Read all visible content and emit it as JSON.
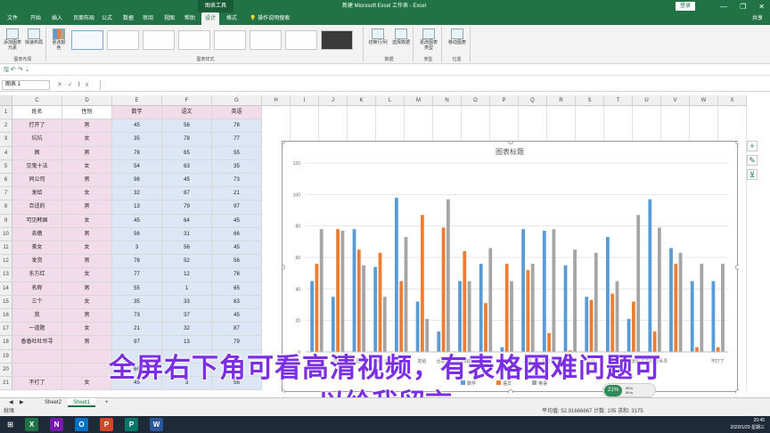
{
  "titlebar": {
    "context_tab": "图表工具",
    "title": "新建 Microsoft Excel 工作表 - Excel",
    "login": "登录",
    "min": "—",
    "restore": "❐",
    "close": "✕"
  },
  "ribbon_tabs": [
    "文件",
    "开始",
    "插入",
    "页面布局",
    "公式",
    "数据",
    "审阅",
    "视图",
    "帮助",
    "设计",
    "格式",
    "操作说明搜索"
  ],
  "active_tab": "设计",
  "share": "共享",
  "ribbon": {
    "add_element": "添加图表元素",
    "quick_layout": "快速布局",
    "layout_group": "图表布局",
    "change_colors": "更改颜色",
    "styles_group": "图表样式",
    "switch_rowcol": "切换行/列",
    "select_data": "选择数据",
    "data_group": "数据",
    "change_type": "更改图表类型",
    "type_group": "类型",
    "move_chart": "移动图表",
    "location_group": "位置"
  },
  "formula_bar": {
    "name_box": "图表 1",
    "cancel": "✕",
    "enter": "✓",
    "fx": "fx",
    "value": ""
  },
  "columns": [
    "C",
    "D",
    "E",
    "F",
    "G",
    "H",
    "I",
    "J",
    "K",
    "L",
    "M",
    "N",
    "O",
    "P",
    "Q",
    "R",
    "S",
    "T",
    "U",
    "V",
    "W",
    "X"
  ],
  "table": {
    "headers": [
      "姓名",
      "性别",
      "数学",
      "语文",
      "英语"
    ],
    "rows": [
      [
        "打开了",
        "男",
        "45",
        "56",
        "78"
      ],
      [
        "坑坑",
        "女",
        "35",
        "78",
        "77"
      ],
      [
        "困",
        "男",
        "78",
        "65",
        "55"
      ],
      [
        "见鬼十法",
        "女",
        "54",
        "63",
        "35"
      ],
      [
        "同公司",
        "男",
        "98",
        "45",
        "73"
      ],
      [
        "发给",
        "女",
        "32",
        "87",
        "21"
      ],
      [
        "合适的",
        "男",
        "13",
        "79",
        "97"
      ],
      [
        "可见韩国",
        "女",
        "45",
        "64",
        "45"
      ],
      [
        "去傲",
        "男",
        "56",
        "31",
        "66"
      ],
      [
        "美女",
        "女",
        "3",
        "56",
        "45"
      ],
      [
        "发货",
        "男",
        "78",
        "52",
        "56"
      ],
      [
        "东方红",
        "女",
        "77",
        "12",
        "78"
      ],
      [
        "名称",
        "男",
        "55",
        "1",
        "65"
      ],
      [
        "三个",
        "女",
        "35",
        "33",
        "63"
      ],
      [
        "我",
        "男",
        "73",
        "37",
        "45"
      ],
      [
        "一道题",
        "女",
        "21",
        "32",
        "87"
      ],
      [
        "香香吐吐吊寻",
        "男",
        "97",
        "13",
        "79"
      ],
      [
        "",
        "",
        "",
        "",
        ""
      ],
      [
        "",
        "",
        "66",
        "",
        ""
      ],
      [
        "不打了",
        "女",
        "45",
        "3",
        "56"
      ]
    ]
  },
  "row_numbers": [
    "1",
    "2",
    "3",
    "4",
    "5",
    "6",
    "7",
    "8",
    "9",
    "10",
    "11",
    "12",
    "13",
    "14",
    "15",
    "16",
    "17",
    "18",
    "19",
    "20",
    "21"
  ],
  "chart_data": {
    "type": "bar",
    "title": "图表标题",
    "ylim": [
      0,
      120
    ],
    "yticks": [
      "0",
      "20",
      "40",
      "60",
      "80",
      "100",
      "120"
    ],
    "categories": [
      "打开了",
      "坑坑",
      "困",
      "见鬼十法",
      "同公司",
      "发给",
      "合适的",
      "可见韩国",
      "去傲",
      "美女",
      "发货",
      "东方红",
      "名称",
      "三个",
      "我",
      "一道题",
      "香香吐吐吊寻",
      "",
      "",
      "不打了"
    ],
    "series": [
      {
        "name": "数学",
        "color": "#5b9bd5",
        "values": [
          45,
          35,
          78,
          54,
          98,
          32,
          13,
          45,
          56,
          3,
          78,
          77,
          55,
          35,
          73,
          21,
          97,
          66,
          45,
          45
        ]
      },
      {
        "name": "语文",
        "color": "#ed7d31",
        "values": [
          56,
          78,
          65,
          63,
          45,
          87,
          79,
          64,
          31,
          56,
          52,
          12,
          1,
          33,
          37,
          32,
          13,
          56,
          3,
          3
        ]
      },
      {
        "name": "英语",
        "color": "#a5a5a5",
        "values": [
          78,
          77,
          55,
          35,
          73,
          21,
          97,
          45,
          66,
          45,
          56,
          78,
          65,
          63,
          45,
          87,
          79,
          63,
          56,
          56
        ]
      }
    ],
    "legend_position": "bottom"
  },
  "chart_tools": {
    "add": "+",
    "style": "✎",
    "filter": "⊻"
  },
  "overlay": {
    "line1": "全屏右下角可看高清视频，有表格困难问题可",
    "line2": "以给我留言"
  },
  "sheets": [
    "Sheet2",
    "Sheet1"
  ],
  "active_sheet": "Sheet1",
  "add_sheet": "+",
  "status": {
    "ready": "就绪",
    "stats": "平均值: 52.91666667   计数: 105   求和: 3175"
  },
  "speed": {
    "pct": "21%",
    "up": "0K/s",
    "down": "0K/s"
  },
  "clock": {
    "time": "20:45",
    "date": "2020/1/29 星期三"
  },
  "taskbar_apps": [
    {
      "icon": "excel-icon",
      "label": "X",
      "color": "#217346"
    },
    {
      "icon": "onenote-icon",
      "label": "N",
      "color": "#7719aa"
    },
    {
      "icon": "outlook-icon",
      "label": "O",
      "color": "#0072c6"
    },
    {
      "icon": "powerpoint-icon",
      "label": "P",
      "color": "#d24726"
    },
    {
      "icon": "publisher-icon",
      "label": "P",
      "color": "#077568"
    },
    {
      "icon": "word-icon",
      "label": "W",
      "color": "#2b579a"
    }
  ]
}
